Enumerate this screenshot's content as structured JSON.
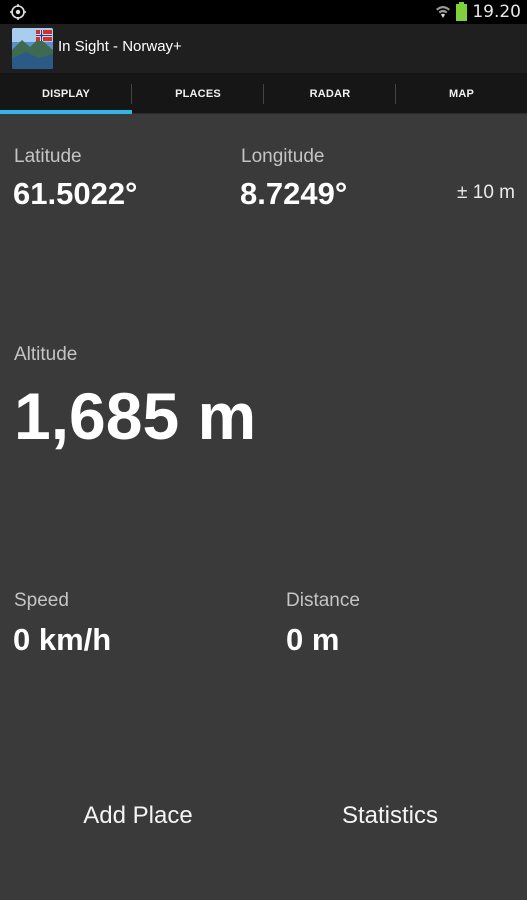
{
  "status_bar": {
    "time": "19.20",
    "left_icon": "location-target-icon",
    "wifi_icon": "wifi-icon",
    "battery_icon": "battery-icon",
    "battery_color": "#7fd13b"
  },
  "app": {
    "title": "In Sight - Norway+",
    "icon": "norway-app-icon"
  },
  "tabs": [
    {
      "label": "DISPLAY",
      "selected": true
    },
    {
      "label": "PLACES",
      "selected": false
    },
    {
      "label": "RADAR",
      "selected": false
    },
    {
      "label": "MAP",
      "selected": false
    }
  ],
  "accent_color": "#33b5e5",
  "position": {
    "latitude_label": "Latitude",
    "latitude_value": "61.5022°",
    "longitude_label": "Longitude",
    "longitude_value": "8.7249°",
    "accuracy": "± 10 m"
  },
  "altitude": {
    "label": "Altitude",
    "value": "1,685 m"
  },
  "speed": {
    "label": "Speed",
    "value": "0 km/h"
  },
  "distance": {
    "label": "Distance",
    "value": "0 m"
  },
  "buttons": {
    "add_place": "Add Place",
    "statistics": "Statistics"
  }
}
